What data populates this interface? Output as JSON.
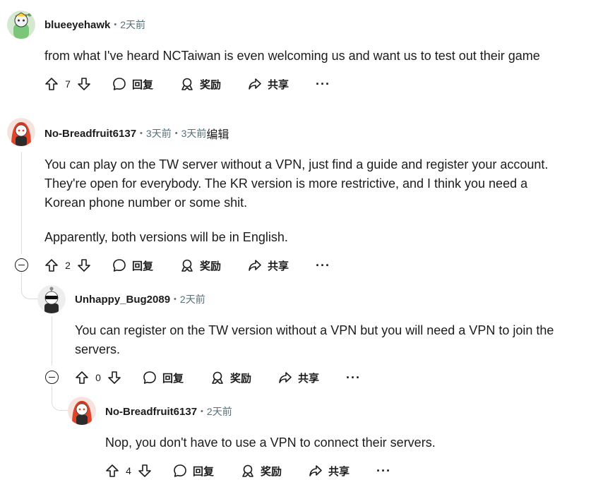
{
  "comments": [
    {
      "username": "blueeyehawk",
      "time": "2天前",
      "body": [
        "from what I've heard NCTaiwan is even welcoming us and want us to test out their game"
      ],
      "votes": "7"
    },
    {
      "username": "No-Breadfruit6137",
      "time": "3天前",
      "edited_time": "3天前",
      "edited_label": "编辑",
      "body": [
        "You can play on the TW server without a VPN, just find a guide and register your account.",
        "They're open for everybody. The KR version is more restrictive, and I think you need a",
        "Korean phone number or some shit.",
        "Apparently, both versions will be in English."
      ],
      "votes": "2"
    },
    {
      "username": "Unhappy_Bug2089",
      "time": "2天前",
      "body": [
        "You can register on the TW version without a VPN but you will need a VPN to join the",
        "servers."
      ],
      "votes": "0"
    },
    {
      "username": "No-Breadfruit6137",
      "time": "2天前",
      "body": [
        "Nop, you don't have to use a VPN to connect their servers."
      ],
      "votes": "4"
    }
  ],
  "actions": {
    "reply": "回复",
    "award": "奖励",
    "share": "共享",
    "more": "···"
  },
  "icons": {
    "upvote": "arrow-up-icon",
    "downvote": "arrow-down-icon",
    "reply": "speech-bubble-icon",
    "award": "award-icon",
    "share": "share-arrow-icon",
    "collapse": "minus-circle-icon"
  },
  "colors": {
    "text": "#1c1c1c",
    "meta": "#576f76",
    "thread_line": "#d9dddf",
    "avatar_hair": "#e0452a",
    "avatar_green": "#7cc67a"
  }
}
